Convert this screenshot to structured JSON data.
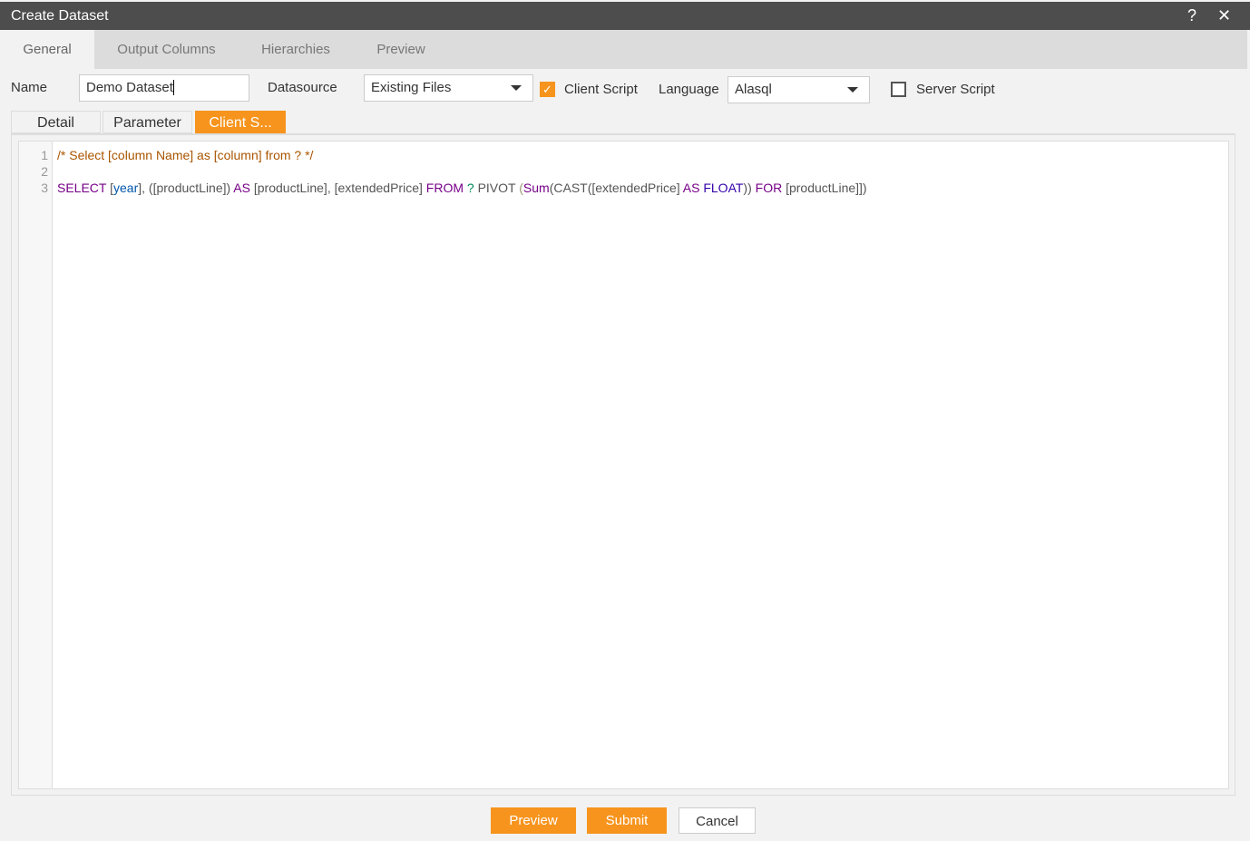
{
  "window": {
    "title": "Create Dataset",
    "help_icon": "?",
    "close_icon": "✕"
  },
  "tabs": [
    {
      "label": "General",
      "active": true
    },
    {
      "label": "Output Columns"
    },
    {
      "label": "Hierarchies"
    },
    {
      "label": "Preview"
    }
  ],
  "form": {
    "name_label": "Name",
    "name_value": "Demo Dataset",
    "datasource_label": "Datasource",
    "datasource_value": "Existing Files",
    "client_script_label": "Client Script",
    "client_script_checked": true,
    "language_label": "Language",
    "language_value": "Alasql",
    "server_script_label": "Server Script",
    "server_script_checked": false
  },
  "subtabs": [
    {
      "label": "Detail"
    },
    {
      "label": "Parameter"
    },
    {
      "label": "Client S...",
      "active": true
    }
  ],
  "editor": {
    "line_numbers": [
      "1",
      "2",
      "3"
    ],
    "line1": "/* Select [column Name] as [column] from ? */",
    "line3": [
      {
        "t": "SELECT",
        "c": "kw"
      },
      {
        "t": " [",
        "c": "plain"
      },
      {
        "t": "year",
        "c": "var"
      },
      {
        "t": "], ([productLine]) ",
        "c": "plain"
      },
      {
        "t": "AS",
        "c": "kw"
      },
      {
        "t": " [productLine], [extendedPrice] ",
        "c": "plain"
      },
      {
        "t": "FROM",
        "c": "kw"
      },
      {
        "t": " ? ",
        "c": "op"
      },
      {
        "t": "PIVOT ",
        "c": "plain"
      },
      {
        "t": "(",
        "c": "br"
      },
      {
        "t": "Sum",
        "c": "kw"
      },
      {
        "t": "(CAST([extendedPrice] ",
        "c": "plain"
      },
      {
        "t": "AS",
        "c": "kw"
      },
      {
        "t": " FLOAT",
        "c": "type"
      },
      {
        "t": ")) ",
        "c": "plain"
      },
      {
        "t": "FOR",
        "c": "kw"
      },
      {
        "t": " [productLine]",
        "c": "plain"
      },
      {
        "t": "])",
        "c": "plain"
      }
    ]
  },
  "footer": {
    "preview_label": "Preview",
    "submit_label": "Submit",
    "cancel_label": "Cancel"
  },
  "colors": {
    "accent": "#f7941d",
    "titlebar": "#4d4d4d"
  }
}
